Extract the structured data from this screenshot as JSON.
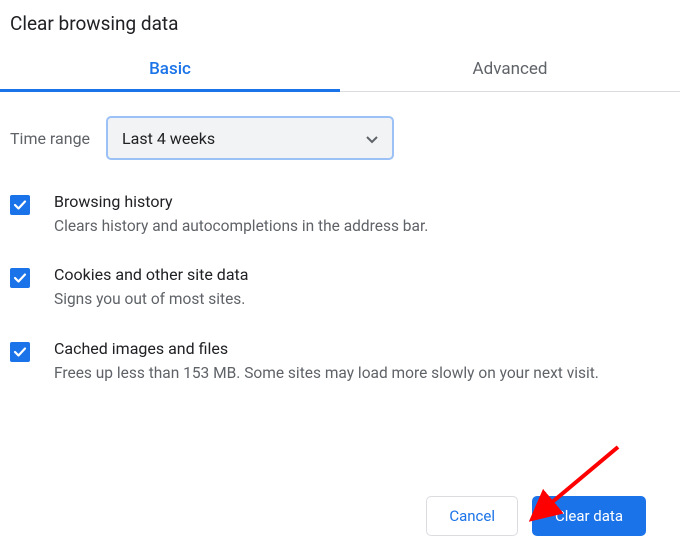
{
  "dialog": {
    "title": "Clear browsing data",
    "tabs": {
      "basic": "Basic",
      "advanced": "Advanced",
      "active": "basic"
    }
  },
  "range": {
    "label": "Time range",
    "selected": "Last 4 weeks"
  },
  "options": [
    {
      "checked": true,
      "title": "Browsing history",
      "desc": "Clears history and autocompletions in the address bar."
    },
    {
      "checked": true,
      "title": "Cookies and other site data",
      "desc": "Signs you out of most sites."
    },
    {
      "checked": true,
      "title": "Cached images and files",
      "desc": "Frees up less than 153 MB. Some sites may load more slowly on your next visit."
    }
  ],
  "buttons": {
    "cancel": "Cancel",
    "clear": "Clear data"
  },
  "colors": {
    "primary": "#1a73e8",
    "text_secondary": "#5f6368",
    "annotation": "#ff0000"
  }
}
